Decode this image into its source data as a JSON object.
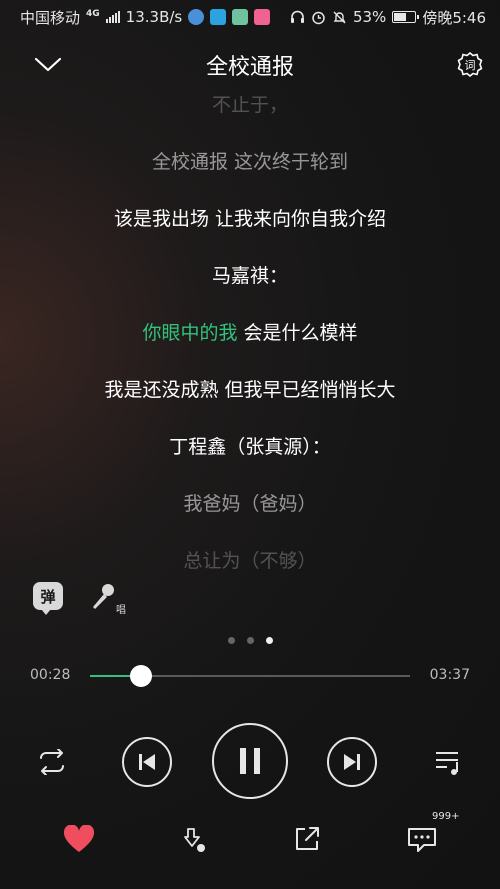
{
  "status_bar": {
    "carrier": "中国移动",
    "network": "4G",
    "speed": "13.3B/s",
    "battery": "53%",
    "time": "傍晚5:46"
  },
  "header": {
    "title": "全校通报"
  },
  "lyrics": {
    "lines": [
      "不止于，",
      "全校通报 这次终于轮到",
      "该是我出场 让我来向你自我介绍",
      "马嘉祺：",
      "你眼中的我 会是什么模样",
      "我是还没成熟 但我早已经悄悄长大",
      "丁程鑫（张真源）：",
      "我爸妈（爸妈）",
      "总让为（不够）"
    ],
    "current_highlight": "你眼中的我",
    "current_rest": " 会是什么模样"
  },
  "side": {
    "danmu_label": "弹",
    "sing_label": "唱"
  },
  "pager": {
    "count": 3,
    "active": 2
  },
  "progress": {
    "current": "00:28",
    "total": "03:37",
    "fraction": 0.16
  },
  "colors": {
    "accent": "#31c27c",
    "like": "#f04d5f"
  },
  "bottom": {
    "comment_count": "999+"
  }
}
